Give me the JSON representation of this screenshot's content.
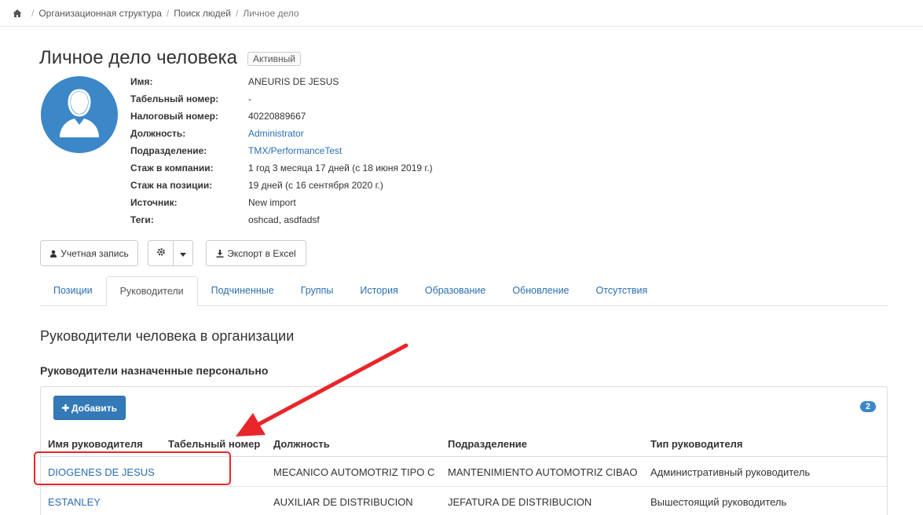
{
  "breadcrumb": {
    "items": [
      "Организационная структура",
      "Поиск людей"
    ],
    "current": "Личное дело"
  },
  "header": {
    "title": "Личное дело человека",
    "status": "Активный"
  },
  "person": {
    "fields": [
      {
        "label": "Имя:",
        "value": "ANEURIS DE JESUS",
        "link": false
      },
      {
        "label": "Табельный номер:",
        "value": "-",
        "link": false
      },
      {
        "label": "Налоговый номер:",
        "value": "40220889667",
        "link": false
      },
      {
        "label": "Должность:",
        "value": "Administrator",
        "link": true
      },
      {
        "label": "Подразделение:",
        "value": "TMX/PerformanceTest",
        "link": true
      },
      {
        "label": "Стаж в компании:",
        "value": "1 год 3 месяца 17 дней (с 18 июня 2019 г.)",
        "link": false
      },
      {
        "label": "Стаж на позиции:",
        "value": "19 дней (с 16 сентября 2020 г.)",
        "link": false
      },
      {
        "label": "Источник:",
        "value": "New import",
        "link": false
      },
      {
        "label": "Теги:",
        "value": "oshcad, asdfadsf",
        "link": false
      }
    ]
  },
  "toolbar": {
    "account_label": "Учетная запись",
    "export_label": "Экспорт в Excel"
  },
  "tabs": [
    {
      "label": "Позиции",
      "active": false
    },
    {
      "label": "Руководители",
      "active": true
    },
    {
      "label": "Подчиненные",
      "active": false
    },
    {
      "label": "Группы",
      "active": false
    },
    {
      "label": "История",
      "active": false
    },
    {
      "label": "Образование",
      "active": false
    },
    {
      "label": "Обновление",
      "active": false
    },
    {
      "label": "Отсутствия",
      "active": false
    }
  ],
  "section": {
    "title": "Руководители человека в организации",
    "subtitle": "Руководители назначенные персонально",
    "add_label": "Добавить",
    "count": "2"
  },
  "table": {
    "columns": [
      "Имя руководителя",
      "Табельный номер",
      "Должность",
      "Подразделение",
      "Тип руководителя"
    ],
    "rows": [
      {
        "name": "DIOGENES DE JESUS",
        "number": "",
        "position": "MECANICO AUTOMOTRIZ TIPO C",
        "department": "MANTENIMIENTO AUTOMOTRIZ CIBAO",
        "type": "Административный руководитель"
      },
      {
        "name": "ESTANLEY",
        "number": "",
        "position": "AUXILIAR DE DISTRIBUCION",
        "department": "JEFATURA DE DISTRIBUCION",
        "type": "Вышестоящий руководитель"
      }
    ]
  },
  "colors": {
    "link": "#2a6fb0",
    "primary": "#337ab7",
    "avatar": "#3b87c8",
    "annotation": "#e8262a"
  }
}
